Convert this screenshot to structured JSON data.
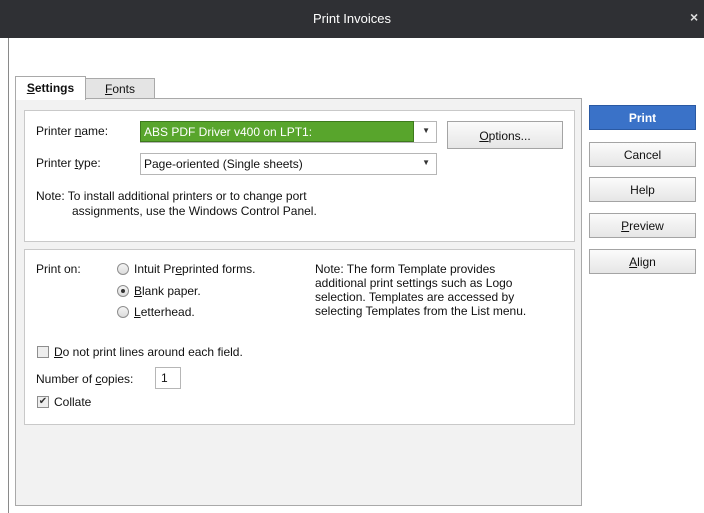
{
  "window": {
    "title": "Print Invoices",
    "close_glyph": "×"
  },
  "tabs": [
    {
      "prefix": "",
      "u": "S",
      "rest": "ettings"
    },
    {
      "prefix": "",
      "u": "F",
      "rest": "onts"
    }
  ],
  "printer": {
    "name_label_a": "Printer ",
    "name_label_u": "n",
    "name_label_b": "ame:",
    "name_value": "ABS PDF Driver v400 on LPT1:",
    "type_label_a": "Printer ",
    "type_label_u": "t",
    "type_label_b": "ype:",
    "type_value": "Page-oriented (Single sheets)",
    "note_line1": "Note: To install additional printers or to change port",
    "note_line2": "assignments, use the Windows Control Panel.",
    "options_u": "O",
    "options_rest": "ptions...",
    "dropdown_glyph": "▼"
  },
  "print_on": {
    "label": "Print on:",
    "option1_a": "Intuit Pr",
    "option1_u": "e",
    "option1_b": "printed forms.",
    "option2_u": "B",
    "option2_b": "lank paper.",
    "option3_u": "L",
    "option3_b": "etterhead.",
    "selected": "Blank paper.",
    "note_lines": [
      "Note: The form Template provides",
      "additional print settings such as Logo",
      "selection.  Templates are accessed by",
      "selecting Templates from the List menu."
    ]
  },
  "options": {
    "no_lines_u": "D",
    "no_lines_b": "o not print lines around each field.",
    "no_lines_checked": false,
    "copies_label_a": "Number of ",
    "copies_label_u": "c",
    "copies_label_b": "opies:",
    "copies_value": "1",
    "collate_label": "Collate",
    "collate_checked": true,
    "check_glyph": "✔"
  },
  "buttons": {
    "print": "Print",
    "cancel": "Cancel",
    "help": "Help",
    "preview_u": "P",
    "preview_b": "review",
    "align_u": "A",
    "align_b": "lign"
  },
  "colors": {
    "titlebar": "#2f3034",
    "selected_printer": "#58a52c",
    "print_button": "#3a72c8"
  }
}
